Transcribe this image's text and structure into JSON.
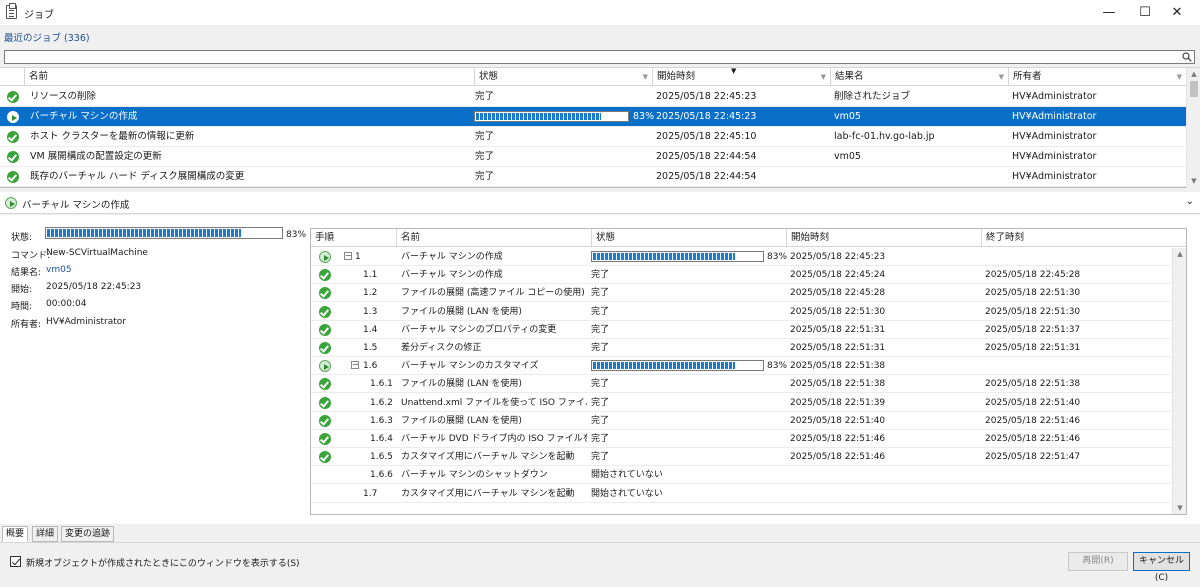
{
  "window": {
    "title": "ジョブ"
  },
  "recent": {
    "label": "最近のジョブ (336)",
    "search_placeholder": ""
  },
  "job_columns": [
    "名前",
    "状態",
    "開始時刻",
    "結果名",
    "所有者"
  ],
  "jobs": [
    {
      "name": "リソースの削除",
      "status": "完了",
      "start": "2025/05/18 22:45:23",
      "result": "削除されたジョブ",
      "owner": "HV¥Administrator",
      "icon": "success-icon"
    },
    {
      "name": "バーチャル マシンの作成",
      "status": "",
      "progress": 0.83,
      "progress_label": "83%",
      "start": "2025/05/18 22:45:23",
      "result": "vm05",
      "owner": "HV¥Administrator",
      "icon": "running-icon"
    },
    {
      "name": "ホスト クラスターを最新の情報に更新",
      "status": "完了",
      "start": "2025/05/18 22:45:10",
      "result": "lab-fc-01.hv.go-lab.jp",
      "owner": "HV¥Administrator",
      "icon": "success-icon"
    },
    {
      "name": "VM 展開構成の配置設定の更新",
      "status": "完了",
      "start": "2025/05/18 22:44:54",
      "result": "vm05",
      "owner": "HV¥Administrator",
      "icon": "success-icon"
    },
    {
      "name": "既存のバーチャル ハード ディスク展開構成の変更",
      "status": "完了",
      "start": "2025/05/18 22:44:54",
      "result": "",
      "owner": "HV¥Administrator",
      "icon": "success-icon"
    }
  ],
  "detail": {
    "title": "バーチャル マシンの作成",
    "labels": {
      "status": "状態:",
      "command": "コマンド:",
      "result": "結果名:",
      "start": "開始:",
      "time": "時間:",
      "owner": "所有者:"
    },
    "progress": 0.83,
    "progress_label": "83%",
    "command": "New-SCVirtualMachine",
    "result": "vm05",
    "start": "2025/05/18 22:45:23",
    "time": "00:00:04",
    "owner": "HV¥Administrator"
  },
  "step_columns": [
    "手順",
    "名前",
    "状態",
    "開始時刻",
    "終了時刻"
  ],
  "steps": [
    {
      "num": "1",
      "name": "バーチャル マシンの作成",
      "status": "",
      "progress": 0.83,
      "progress_label": "83%",
      "start": "2025/05/18 22:45:23",
      "end": "",
      "icon": "running-icon",
      "expander": "⊟"
    },
    {
      "num": "1.1",
      "name": "バーチャル マシンの作成",
      "status": "完了",
      "start": "2025/05/18 22:45:24",
      "end": "2025/05/18 22:45:28",
      "icon": "success-icon"
    },
    {
      "num": "1.2",
      "name": "ファイルの展開 (高速ファイル コピーの使用)",
      "status": "完了",
      "start": "2025/05/18 22:45:28",
      "end": "2025/05/18 22:51:30",
      "icon": "success-icon"
    },
    {
      "num": "1.3",
      "name": "ファイルの展開 (LAN を使用)",
      "status": "完了",
      "start": "2025/05/18 22:51:30",
      "end": "2025/05/18 22:51:30",
      "icon": "success-icon"
    },
    {
      "num": "1.4",
      "name": "バーチャル マシンのプロパティの変更",
      "status": "完了",
      "start": "2025/05/18 22:51:31",
      "end": "2025/05/18 22:51:37",
      "icon": "success-icon"
    },
    {
      "num": "1.5",
      "name": "差分ディスクの修正",
      "status": "完了",
      "start": "2025/05/18 22:51:31",
      "end": "2025/05/18 22:51:31",
      "icon": "success-icon"
    },
    {
      "num": "1.6",
      "name": "バーチャル マシンのカスタマイズ",
      "status": "",
      "progress": 0.83,
      "progress_label": "83%",
      "start": "2025/05/18 22:51:38",
      "end": "",
      "icon": "running-icon",
      "expander": "⊟"
    },
    {
      "num": "1.6.1",
      "name": "ファイルの展開 (LAN を使用)",
      "status": "完了",
      "start": "2025/05/18 22:51:38",
      "end": "2025/05/18 22:51:38",
      "icon": "success-icon"
    },
    {
      "num": "1.6.2",
      "name": "Unattend.xml ファイルを使って ISO ファイルを作...",
      "status": "完了",
      "start": "2025/05/18 22:51:39",
      "end": "2025/05/18 22:51:40",
      "icon": "success-icon"
    },
    {
      "num": "1.6.3",
      "name": "ファイルの展開 (LAN を使用)",
      "status": "完了",
      "start": "2025/05/18 22:51:40",
      "end": "2025/05/18 22:51:46",
      "icon": "success-icon"
    },
    {
      "num": "1.6.4",
      "name": "バーチャル DVD ドライブ内の ISO ファイルをバーチ...",
      "status": "完了",
      "start": "2025/05/18 22:51:46",
      "end": "2025/05/18 22:51:46",
      "icon": "success-icon"
    },
    {
      "num": "1.6.5",
      "name": "カスタマイズ用にバーチャル マシンを起動",
      "status": "完了",
      "start": "2025/05/18 22:51:46",
      "end": "2025/05/18 22:51:47",
      "icon": "success-icon"
    },
    {
      "num": "1.6.6",
      "name": "バーチャル マシンのシャットダウン",
      "status": "開始されていない",
      "start": "",
      "end": "",
      "icon": ""
    },
    {
      "num": "1.7",
      "name": "カスタマイズ用にバーチャル マシンを起動",
      "status": "開始されていない",
      "start": "",
      "end": "",
      "icon": ""
    }
  ],
  "tabs": [
    "概要",
    "詳細",
    "変更の追跡"
  ],
  "footer": {
    "checkbox_label": "新規オブジェクトが作成されたときにこのウィンドウを表示する(S)",
    "restart": "再開(R)",
    "cancel": "キャンセル(C)"
  },
  "colors": {
    "accent": "#0a6fc9",
    "progress": "#1a7bd3",
    "success": "#3aa33a"
  }
}
